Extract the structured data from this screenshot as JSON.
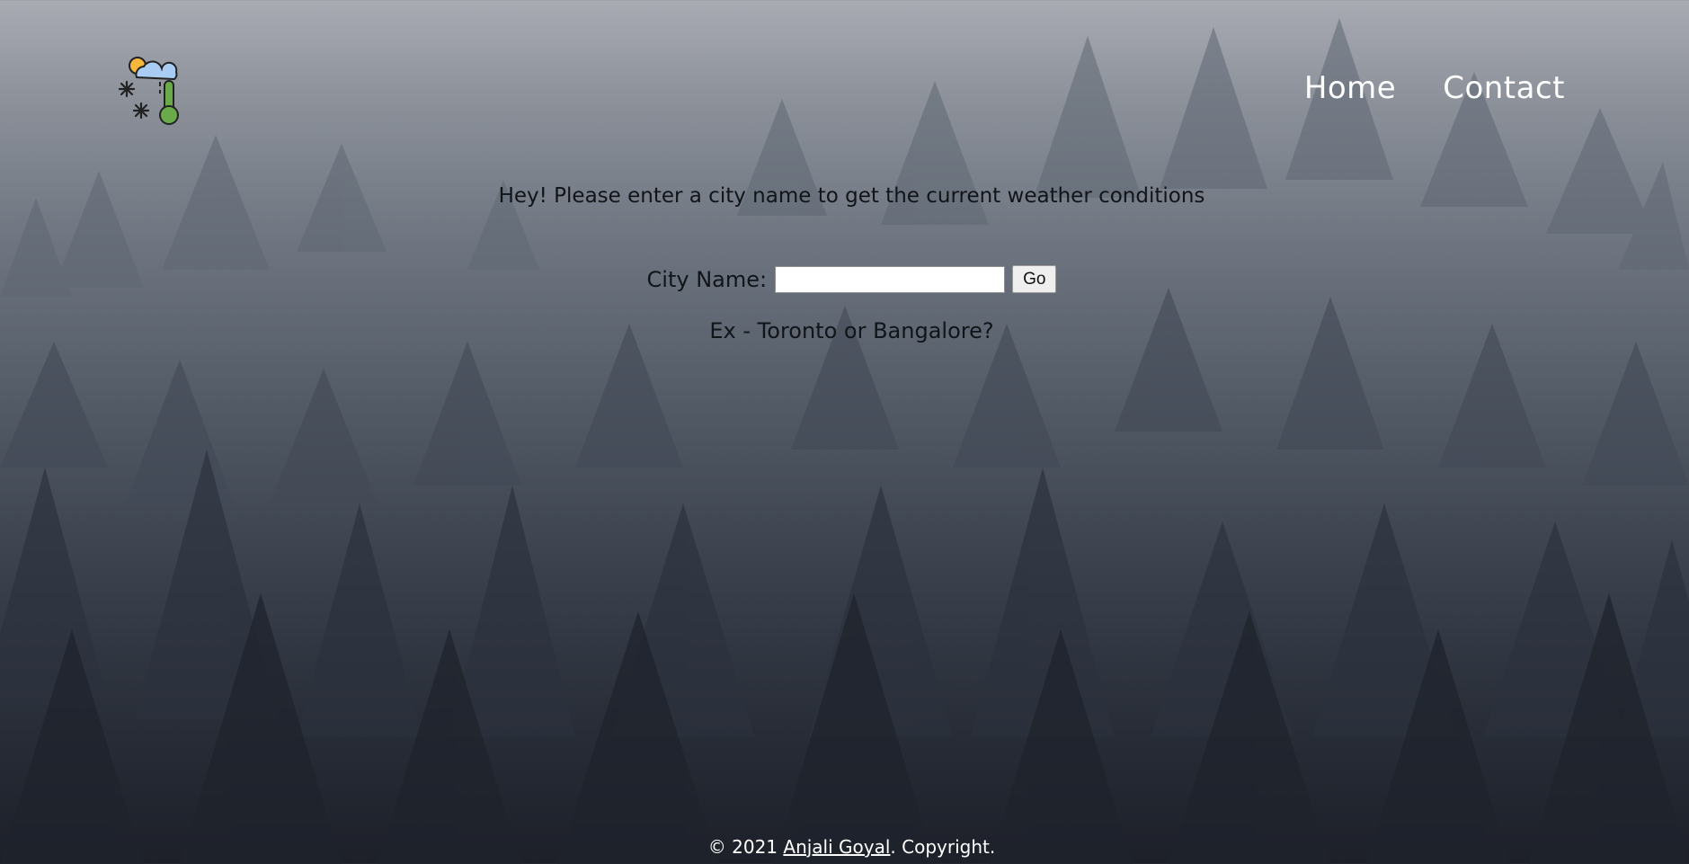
{
  "nav": {
    "items": [
      {
        "label": "Home"
      },
      {
        "label": "Contact"
      }
    ]
  },
  "logo": {
    "icon": "weather-thermometer-icon"
  },
  "main": {
    "intro_text": "Hey! Please enter a city name to get the current weather conditions",
    "city_label": "City Name:",
    "city_value": "",
    "go_button": "Go",
    "example_text": "Ex - Toronto or Bangalore?"
  },
  "footer": {
    "prefix": "© 2021 ",
    "author": "Anjali Goyal",
    "suffix": ". Copyright."
  },
  "colors": {
    "sky_top": "#a9abb3",
    "forest_bottom": "#1d2029",
    "text_dark": "#111418",
    "nav_text": "#ffffff"
  }
}
